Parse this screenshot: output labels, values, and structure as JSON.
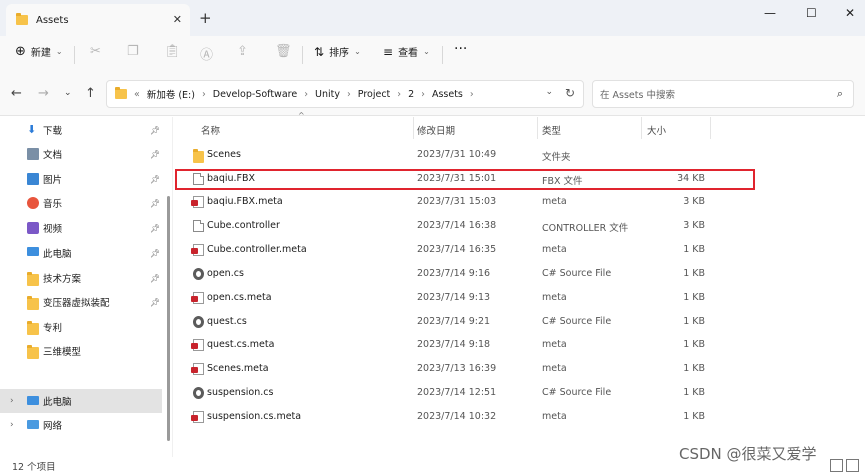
{
  "window": {
    "tab_title": "Assets",
    "new_tab": "+",
    "minimize": "—",
    "maximize": "☐",
    "close": "✕"
  },
  "toolbar": {
    "new_label": "新建",
    "sort_label": "排序",
    "view_label": "查看",
    "more": "···"
  },
  "address": {
    "crumbs": [
      "新加卷 (E:)",
      "Develop-Software",
      "Unity",
      "Project",
      "2",
      "Assets"
    ],
    "prefix": "«",
    "separator": "›"
  },
  "search": {
    "placeholder": "在 Assets 中搜索"
  },
  "sidebar": {
    "items": [
      {
        "label": "下载",
        "icon": "download-icon",
        "pinned": true
      },
      {
        "label": "文档",
        "icon": "documents-icon",
        "pinned": true
      },
      {
        "label": "图片",
        "icon": "pictures-icon",
        "pinned": true
      },
      {
        "label": "音乐",
        "icon": "music-icon",
        "pinned": true
      },
      {
        "label": "视频",
        "icon": "videos-icon",
        "pinned": true
      },
      {
        "label": "此电脑",
        "icon": "pc-icon",
        "pinned": true
      },
      {
        "label": "技术方案",
        "icon": "folder-icon",
        "pinned": true
      },
      {
        "label": "变压器虚拟装配",
        "icon": "folder-icon",
        "pinned": true
      },
      {
        "label": "专利",
        "icon": "folder-icon",
        "pinned": false
      },
      {
        "label": "三维模型",
        "icon": "folder-icon",
        "pinned": false
      }
    ],
    "tree": [
      {
        "label": "此电脑",
        "icon": "pc-icon",
        "selected": true
      },
      {
        "label": "网络",
        "icon": "network-icon",
        "selected": false
      }
    ]
  },
  "columns": {
    "name": "名称",
    "date": "修改日期",
    "type": "类型",
    "size": "大小"
  },
  "files": [
    {
      "name": "Scenes",
      "date": "2023/7/31 10:49",
      "type": "文件夹",
      "size": "",
      "icon": "folder-icon"
    },
    {
      "name": "baqiu.FBX",
      "date": "2023/7/31 15:01",
      "type": "FBX 文件",
      "size": "34 KB",
      "icon": "file-icon",
      "highlighted": true
    },
    {
      "name": "baqiu.FBX.meta",
      "date": "2023/7/31 15:03",
      "type": "meta",
      "size": "3 KB",
      "icon": "meta-icon"
    },
    {
      "name": "Cube.controller",
      "date": "2023/7/14 16:38",
      "type": "CONTROLLER 文件",
      "size": "3 KB",
      "icon": "file-icon"
    },
    {
      "name": "Cube.controller.meta",
      "date": "2023/7/14 16:35",
      "type": "meta",
      "size": "1 KB",
      "icon": "meta-icon"
    },
    {
      "name": "open.cs",
      "date": "2023/7/14 9:16",
      "type": "C# Source File",
      "size": "1 KB",
      "icon": "cs-icon"
    },
    {
      "name": "open.cs.meta",
      "date": "2023/7/14 9:13",
      "type": "meta",
      "size": "1 KB",
      "icon": "meta-icon"
    },
    {
      "name": "quest.cs",
      "date": "2023/7/14 9:21",
      "type": "C# Source File",
      "size": "1 KB",
      "icon": "cs-icon"
    },
    {
      "name": "quest.cs.meta",
      "date": "2023/7/14 9:18",
      "type": "meta",
      "size": "1 KB",
      "icon": "meta-icon"
    },
    {
      "name": "Scenes.meta",
      "date": "2023/7/13 16:39",
      "type": "meta",
      "size": "1 KB",
      "icon": "meta-icon"
    },
    {
      "name": "suspension.cs",
      "date": "2023/7/14 12:51",
      "type": "C# Source File",
      "size": "1 KB",
      "icon": "cs-icon"
    },
    {
      "name": "suspension.cs.meta",
      "date": "2023/7/14 10:32",
      "type": "meta",
      "size": "1 KB",
      "icon": "meta-icon"
    }
  ],
  "status": {
    "count": "12 个项目"
  },
  "watermark": "CSDN @很菜又爱学"
}
